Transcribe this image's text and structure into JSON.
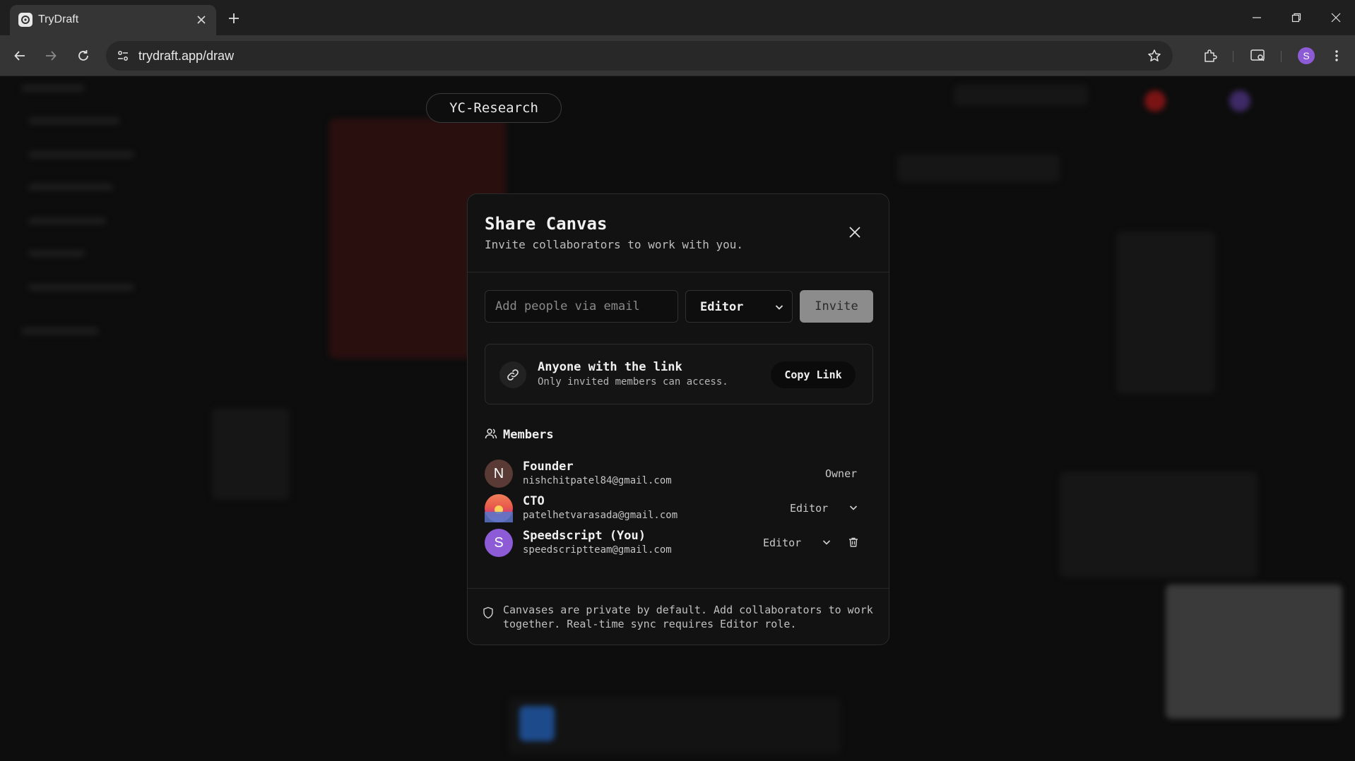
{
  "browser": {
    "tab_title": "TryDraft",
    "url": "trydraft.app/draw",
    "profile_initial": "S"
  },
  "app": {
    "canvas_name": "YC-Research"
  },
  "share_modal": {
    "title": "Share Canvas",
    "subtitle": "Invite collaborators to work with you.",
    "email_placeholder": "Add people via email",
    "role_selected": "Editor",
    "invite_label": "Invite",
    "link_access": {
      "title": "Anyone with the link",
      "subtitle": "Only invited members can access.",
      "copy_label": "Copy Link"
    },
    "members_heading": "Members",
    "members": [
      {
        "name": "Founder",
        "email": "nishchitpatel84@gmail.com",
        "role": "Owner",
        "initial": "N",
        "avatar_color": "#5a3a35"
      },
      {
        "name": "CTO",
        "email": "patelhetvarasada@gmail.com",
        "role": "Editor",
        "initial": "",
        "avatar_color": "#e8604c"
      },
      {
        "name": "Speedscript (You)",
        "email": "speedscriptteam@gmail.com",
        "role": "Editor",
        "initial": "S",
        "avatar_color": "#8e5bd6"
      }
    ],
    "footer_note": "Canvases are private by default. Add collaborators to work together. Real-time sync requires Editor role."
  }
}
